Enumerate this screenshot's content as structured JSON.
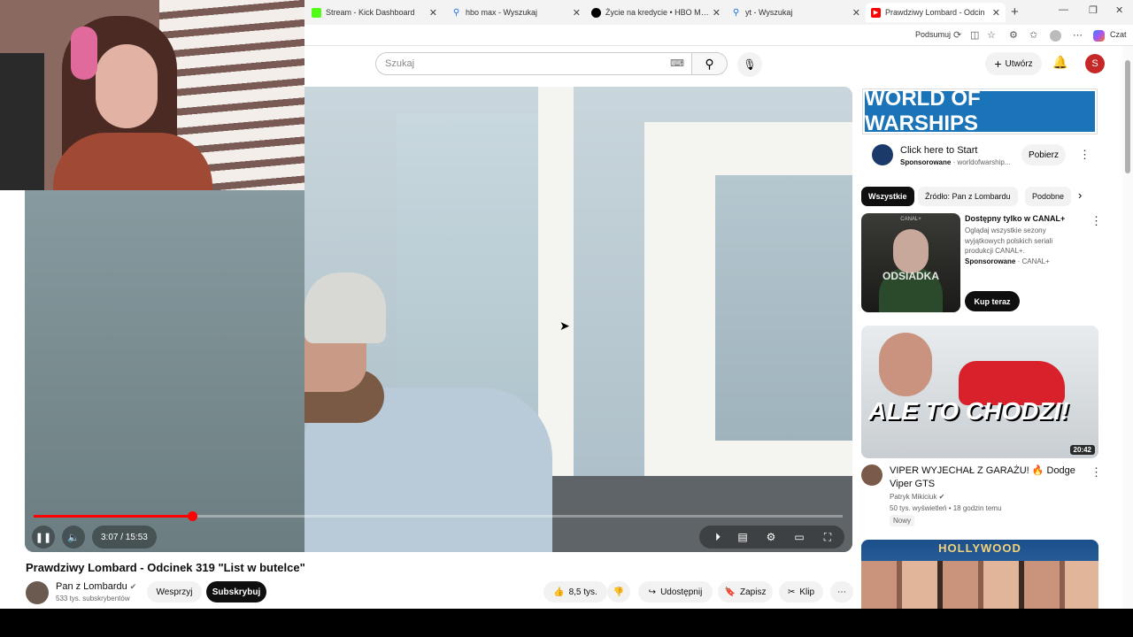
{
  "tabs": [
    {
      "title": "Stream - Kick Dashboard",
      "favicon_color": "#53fc18"
    },
    {
      "title": "hbo max - Wyszukaj",
      "favicon_color": "#1a73e8"
    },
    {
      "title": "Życie na kredycie • HBO Max",
      "favicon_color": "#000000"
    },
    {
      "title": "yt - Wyszukaj",
      "favicon_color": "#1a73e8"
    },
    {
      "title": "Prawdziwy Lombard - Odcin",
      "favicon_color": "#ff0000"
    }
  ],
  "browser": {
    "summarize_label": "Podsumuj",
    "chat_label": "Czat"
  },
  "header": {
    "search_placeholder": "Szukaj",
    "create_label": "Utwórz",
    "avatar_letter": "S"
  },
  "player": {
    "current_time": "3:07",
    "duration": "15:53",
    "time_display": "3:07 / 15:53",
    "progress": 0.196,
    "accent_color": "#ff0000"
  },
  "video": {
    "title": "Prawdziwy Lombard - Odcinek 319 \"List w butelce\"",
    "channel": "Pan z Lombardu",
    "subscribers": "533 tys. subskrybentów",
    "support_label": "Wesprzyj",
    "subscribe_label": "Subskrybuj",
    "likes": "8,5 tys.",
    "share_label": "Udostępnij",
    "save_label": "Zapisz",
    "clip_label": "Klip"
  },
  "sidebar": {
    "ad_banner_text": "WORLD OF WARSHIPS",
    "ad_cta_title": "Click here to Start",
    "ad_sponsored": "Sponsorowane",
    "ad_domain": "worldofwarship...",
    "ad_button": "Pobierz",
    "chips": [
      "Wszystkie",
      "Źródło: Pan z Lombardu",
      "Podobne"
    ],
    "items": [
      {
        "thumb_small": "CANAL+",
        "thumb_title": "ODSIADKA",
        "title": "Dostępny tylko w CANAL+",
        "description": "Oglądaj wszystkie sezony wyjątkowych polskich seriali produkcji CANAL+.",
        "sponsored": "Sponsorowane",
        "advertiser": "CANAL+",
        "button": "Kup teraz"
      },
      {
        "thumb_text": "ALE TO CHODZI!",
        "duration": "20:42",
        "title": "VIPER WYJECHAŁ Z GARAŻU! 🔥 Dodge Viper GTS",
        "channel": "Patryk Mikiciuk",
        "meta": "50 tys. wyświetleń • 18 godzin temu",
        "badge": "Nowy"
      },
      {
        "thumb_text": "HOLLYWOOD"
      }
    ]
  }
}
